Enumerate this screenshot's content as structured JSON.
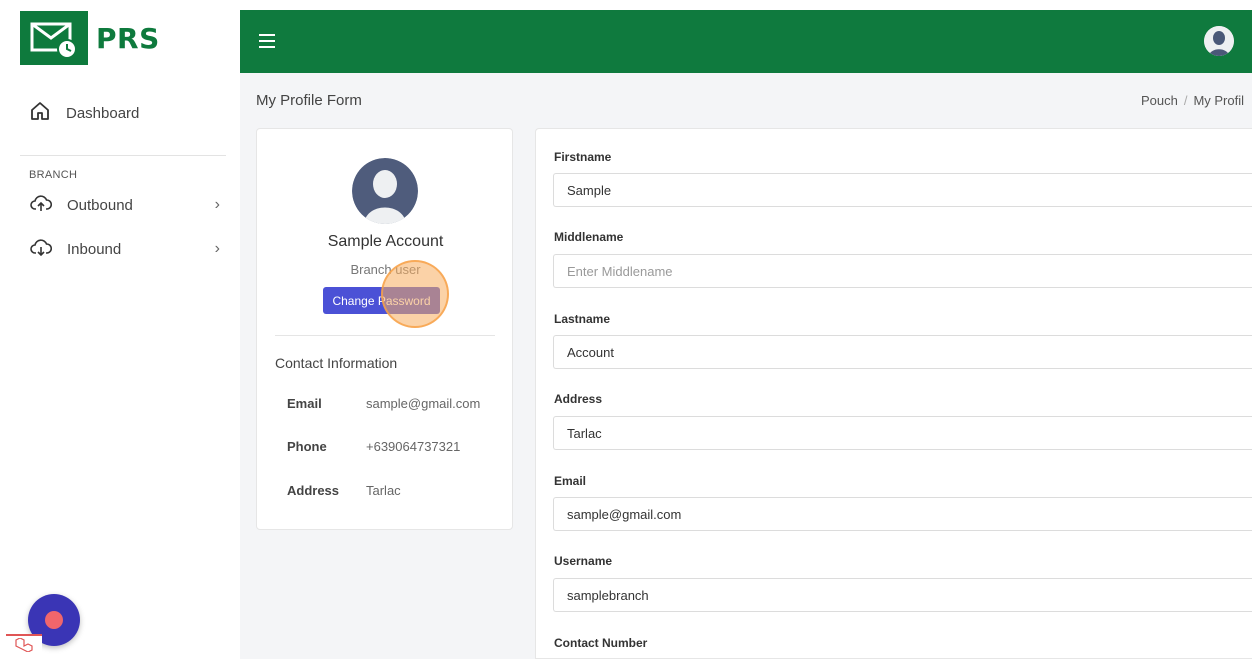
{
  "brand": {
    "name": "PRS"
  },
  "sidebar": {
    "dashboard_label": "Dashboard",
    "section_label": "BRANCH",
    "items": [
      {
        "label": "Outbound",
        "icon": "cloud-upload-icon"
      },
      {
        "label": "Inbound",
        "icon": "cloud-download-icon"
      }
    ]
  },
  "header": {
    "page_title": "My Profile Form",
    "breadcrumb": [
      "Pouch",
      "My Profil"
    ]
  },
  "profile": {
    "name": "Sample Account",
    "role": "Branch user",
    "change_password_label": "Change Password",
    "contact_title": "Contact Information",
    "contacts": [
      {
        "label": "Email",
        "value": "sample@gmail.com"
      },
      {
        "label": "Phone",
        "value": "+639064737321"
      },
      {
        "label": "Address",
        "value": "Tarlac"
      }
    ]
  },
  "form": {
    "firstname": {
      "label": "Firstname",
      "value": "Sample"
    },
    "middlename": {
      "label": "Middlename",
      "value": "",
      "placeholder": "Enter Middlename"
    },
    "lastname": {
      "label": "Lastname",
      "value": "Account"
    },
    "address": {
      "label": "Address",
      "value": "Tarlac"
    },
    "email": {
      "label": "Email",
      "value": "sample@gmail.com"
    },
    "username": {
      "label": "Username",
      "value": "samplebranch"
    },
    "contact_number": {
      "label": "Contact Number"
    }
  },
  "colors": {
    "topbar": "#0f7a3e",
    "brand": "#0e7a3d",
    "primary_button": "#4b51d6",
    "fab": "#3a35b5"
  }
}
